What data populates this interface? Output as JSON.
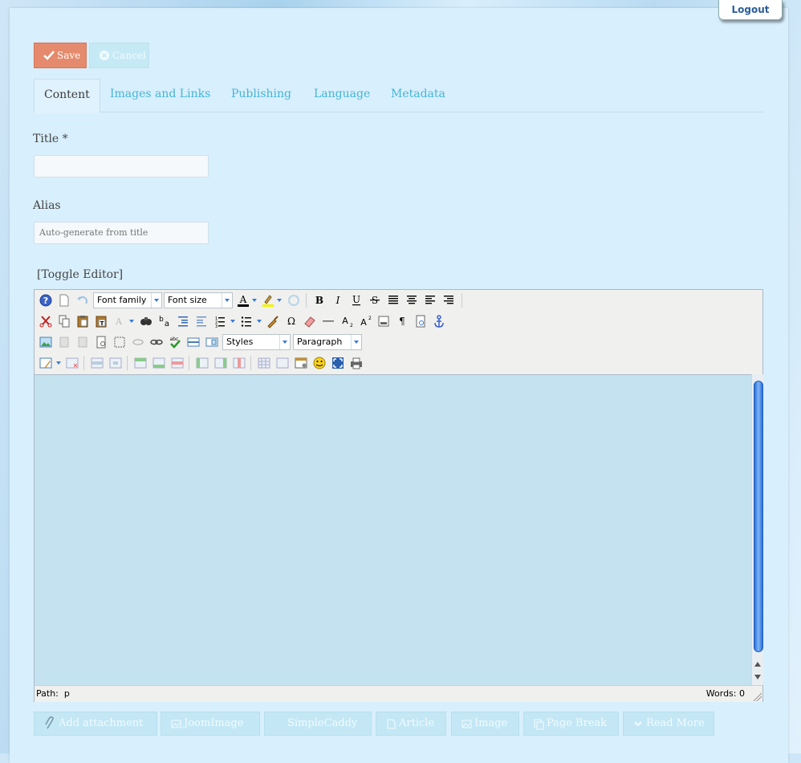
{
  "header": {
    "logout_label": "Logout"
  },
  "toolbar": {
    "save_label": "Save",
    "cancel_label": "Cancel"
  },
  "tabs": [
    {
      "label": "Content",
      "active": true
    },
    {
      "label": "Images and Links"
    },
    {
      "label": "Publishing"
    },
    {
      "label": "Language"
    },
    {
      "label": "Metadata"
    }
  ],
  "form": {
    "title_label": "Title *",
    "title_value": "",
    "alias_label": "Alias",
    "alias_placeholder": "Auto-generate from title",
    "toggle_editor": "[Toggle Editor]"
  },
  "editor": {
    "font_family": "Font family",
    "font_size": "Font size",
    "styles": "Styles",
    "format": "Paragraph",
    "path_label": "Path:",
    "path_value": "p",
    "words_label": "Words: 0"
  },
  "editor_buttons": [
    {
      "label": "Add attachment",
      "icon": "paperclip-icon"
    },
    {
      "label": "JoomImage",
      "icon": "image-icon"
    },
    {
      "label": "SimpleCaddy",
      "icon": ""
    },
    {
      "label": "Article",
      "icon": "document-icon"
    },
    {
      "label": "Image",
      "icon": "image-icon"
    },
    {
      "label": "Page Break",
      "icon": "pages-icon"
    },
    {
      "label": "Read More",
      "icon": "chevron-down-icon"
    }
  ],
  "colors": {
    "save_button": "#e58a6c",
    "tab_link": "#45b5d6",
    "editor_bg": "#c4e2f0",
    "panel_bg": "#d8effd"
  }
}
